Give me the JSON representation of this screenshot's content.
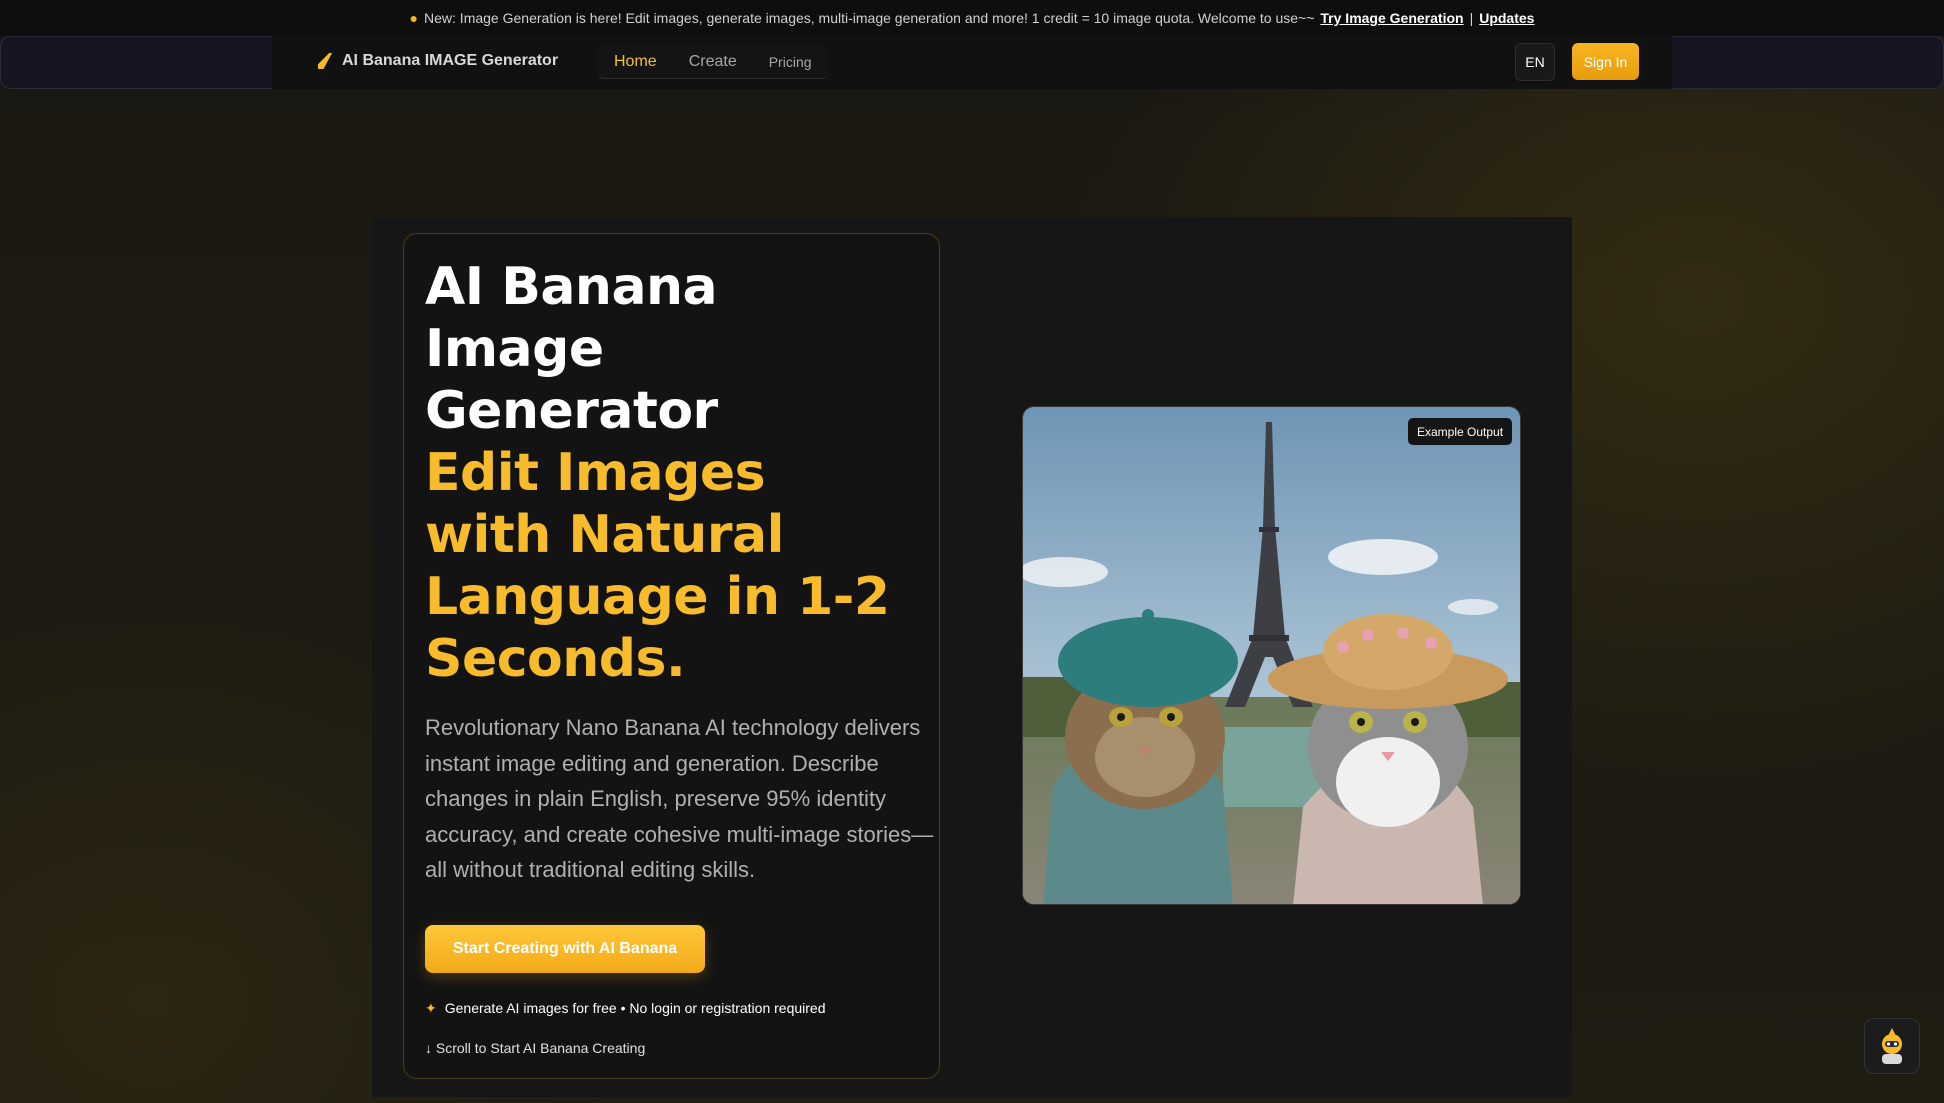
{
  "announcement": {
    "text": "New: Image Generation is here! Edit images, generate images, multi-image generation and more! 1 credit = 10 image quota. Welcome to use~~",
    "link_try": "Try Image Generation",
    "separator": "|",
    "link_updates": "Updates"
  },
  "nav": {
    "brand": "AI Banana IMAGE Generator",
    "links": [
      {
        "label": "Home"
      },
      {
        "label": "Create"
      },
      {
        "label": "Pricing"
      }
    ],
    "language": "EN",
    "sign_in": "Sign In"
  },
  "hero": {
    "title_lines": [
      "AI Banana",
      "Image",
      "Generator"
    ],
    "subtitle_lines": [
      "Edit Images",
      "with Natural",
      "Language in 1-2",
      "Seconds."
    ],
    "description": "Revolutionary Nano Banana AI technology delivers instant image editing and generation. Describe changes in plain English, preserve 95% identity accuracy, and create cohesive multi-image stories—all without traditional editing skills.",
    "cta": "Start Creating with AI Banana",
    "free_note": "Generate AI images for free • No login or registration required",
    "scroll_note": "↓ Scroll to Start AI Banana Creating",
    "example_badge": "Example Output"
  },
  "icons": {
    "announce": "banana-emoji-icon",
    "brand": "banana-logo-icon",
    "sparkle": "sparkle-icon",
    "chat": "chat-bot-icon"
  },
  "colors": {
    "accent": "#f7bb2c",
    "background": "#1a1811",
    "card_border": "#4b3e14"
  }
}
